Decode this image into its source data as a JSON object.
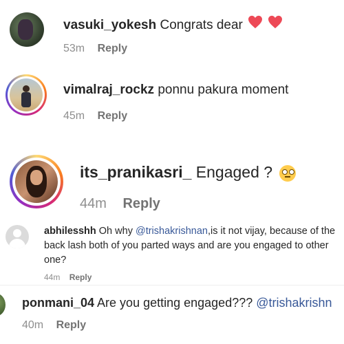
{
  "comments": [
    {
      "username": "vasuki_yokesh",
      "text": "Congrats dear",
      "time": "53m",
      "reply": "Reply"
    },
    {
      "username": "vimalraj_rockz",
      "text": "ponnu pakura moment",
      "time": "45m",
      "reply": "Reply"
    },
    {
      "username": "its_pranikasri_",
      "text": "Engaged ?",
      "time": "44m",
      "reply": "Reply"
    },
    {
      "username": "abhilesshh",
      "text_before": "Oh why",
      "mention": "@trishakrishnan",
      "text_after": ",is it not vijay, because of the back lash both of you parted ways and are you engaged to other one?",
      "time": "44m",
      "reply": "Reply"
    },
    {
      "username": "ponmani_04",
      "text": "Are you getting engaged???",
      "mention": "@trishakrishn",
      "time": "40m",
      "reply": "Reply"
    }
  ],
  "icons": {
    "heart": "heart-icon",
    "rolling_eyes": "rolling-eyes-emoji-icon",
    "default_avatar": "default-avatar-icon"
  },
  "colors": {
    "heart": "#ed4956",
    "link": "#385898",
    "muted": "#8e8e8e"
  }
}
